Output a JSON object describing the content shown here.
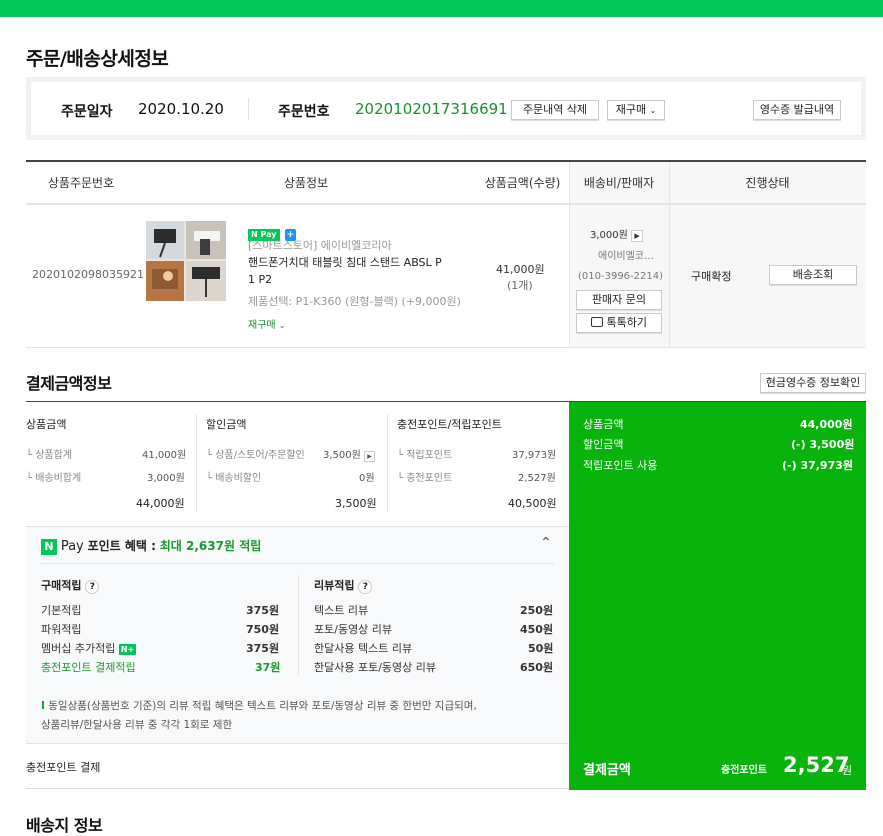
{
  "page_title": "주문/배송상세정보",
  "order": {
    "date_label": "주문일자",
    "date_value": "2020.10.20",
    "number_label": "주문번호",
    "number_value": "2020102017316691",
    "delete_button": "주문내역 삭제",
    "rebuy_button": "재구매",
    "receipt_button": "영수증 발급내역"
  },
  "product_table": {
    "headers": [
      "상품주문번호",
      "상품정보",
      "상품금액(수량)",
      "배송비/판매자",
      "진행상태"
    ],
    "row": {
      "product_order_no": "2020102098035921",
      "npay_badge": "Pay",
      "store": "[스마트스토어] 에이비엘코리아",
      "name_line1": "핸드폰거치대 태블릿 침대 스탠드 ABSL P",
      "name_line2": "1 P2",
      "option": "제품선택: P1-K360 (원형-블랙) (+9,000원)",
      "rebuy": "재구매",
      "price": "41,000원",
      "qty": "(1개)",
      "shipping_fee": "3,000원",
      "seller": "에이비엘코…",
      "phone": "(010-3996-2214)",
      "inquiry_button": "판매자 문의",
      "talk_button": "톡톡하기",
      "status": "구매확정",
      "track_button": "배송조회"
    }
  },
  "payment": {
    "title": "결제금액정보",
    "cash_receipt_button": "현금영수증 정보확인",
    "col1": {
      "title": "상품금액",
      "rows": [
        [
          "상품합계",
          "41,000원"
        ],
        [
          "배송비합계",
          "3,000원"
        ]
      ],
      "total": "44,000원"
    },
    "col2": {
      "title": "할인금액",
      "rows": [
        [
          "상품/스토어/주문할인",
          "3,500원"
        ],
        [
          "배송비할인",
          "0원"
        ]
      ],
      "total": "3,500원"
    },
    "col3": {
      "title": "충전포인트/적립포인트",
      "rows": [
        [
          "적립포인트",
          "37,973원"
        ],
        [
          "충전포인트",
          "2,527원"
        ]
      ],
      "total": "40,500원"
    },
    "summary": [
      [
        "상품금액",
        "44,000원"
      ],
      [
        "할인금액",
        "(-) 3,500원"
      ],
      [
        "적립포인트 사용",
        "(-) 37,973원"
      ]
    ],
    "final_label": "결제금액",
    "final_sub": "충전포인트",
    "final_amount": "2,527",
    "final_unit": "원",
    "method": "충전포인트 결제"
  },
  "benefit": {
    "pay_text": "Pay",
    "title": "포인트 혜택 :",
    "highlight": "최대 2,637원 적립",
    "purchase_title": "구매적립",
    "purchase_rows": [
      [
        "기본적립",
        "375원"
      ],
      [
        "파워적립",
        "750원"
      ],
      [
        "멤버십 추가적립",
        "375원"
      ],
      [
        "충전포인트 결제적립",
        "37원"
      ]
    ],
    "review_title": "리뷰적립",
    "review_rows": [
      [
        "텍스트 리뷰",
        "250원"
      ],
      [
        "포토/동영상 리뷰",
        "450원"
      ],
      [
        "한달사용 텍스트 리뷰",
        "50원"
      ],
      [
        "한달사용 포토/동영상 리뷰",
        "650원"
      ]
    ],
    "note_line1": "동일상품(상품번호 기준)의 리뷰 적립 혜택은 텍스트 리뷰와 포토/동영상 리뷰 중 한번만 지급되며,",
    "note_line2": "상품리뷰/한달사용 리뷰 중 각각 1회로 제한"
  },
  "shipping_section_title": "배송지 정보",
  "colors": {
    "brand_green": "#03c75a",
    "panel_green": "#08b30c",
    "order_number": "#1a8f2e"
  }
}
